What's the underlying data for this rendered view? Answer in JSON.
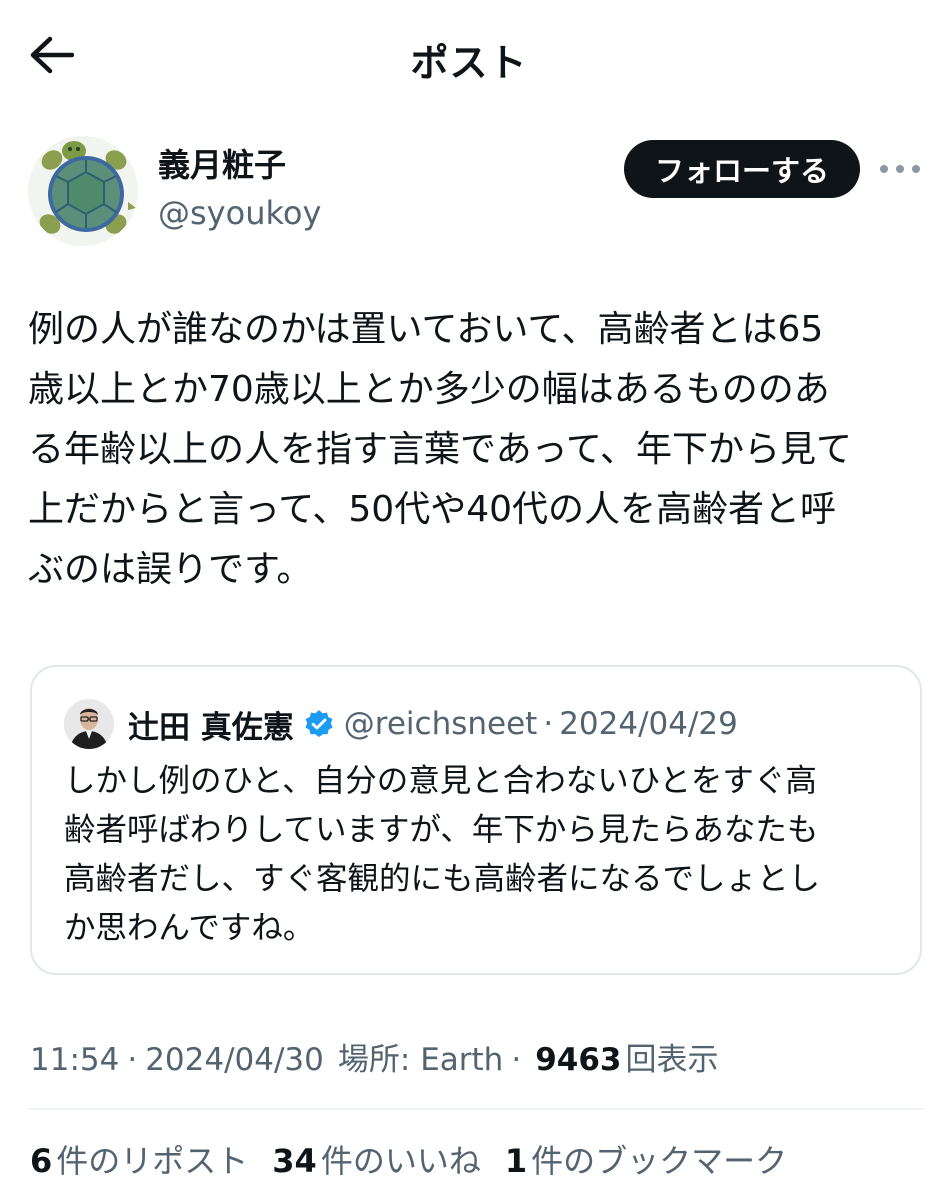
{
  "header": {
    "title": "ポスト",
    "back_icon": "arrow-left-icon"
  },
  "author": {
    "display_name": "義月粧子",
    "handle": "@syoukoy",
    "avatar_icon": "turtle-avatar",
    "follow_label": "フォローする",
    "more_icon": "more-horizontal-icon"
  },
  "post": {
    "text": "例の人が誰なのかは置いておいて、高齢者とは65\n歳以上とか70歳以上とか多少の幅はあるもののあ\nる年齢以上の人を指す言葉であって、年下から見て\n上だからと言って、50代や40代の人を高齢者と呼\nぶのは誤りです。"
  },
  "quote": {
    "name": "辻田 真佐憲",
    "verified_icon": "verified-badge-icon",
    "handle": "@reichsneet",
    "separator": "·",
    "date": "2024/04/29",
    "text": "しかし例のひと、自分の意見と合わないひとをすぐ高\n齢者呼ばわりしていますが、年下から見たらあなたも\n高齢者だし、すぐ客観的にも高齢者になるでしょとし\nか思わんですね。"
  },
  "meta": {
    "time": "11:54",
    "separator": "·",
    "date": "2024/04/30",
    "location": "場所: Earth",
    "views_count": "9463",
    "views_label": "回表示"
  },
  "stats": {
    "reposts_count": "6",
    "reposts_label": "件のリポスト",
    "likes_count": "34",
    "likes_label": "件のいいね",
    "bookmarks_count": "1",
    "bookmarks_label": "件のブックマーク"
  },
  "colors": {
    "text_primary": "#0f1419",
    "text_secondary": "#536471",
    "follow_button_bg": "#0f1419",
    "verified_blue": "#1d9bf0",
    "border": "#e1e6ea"
  }
}
